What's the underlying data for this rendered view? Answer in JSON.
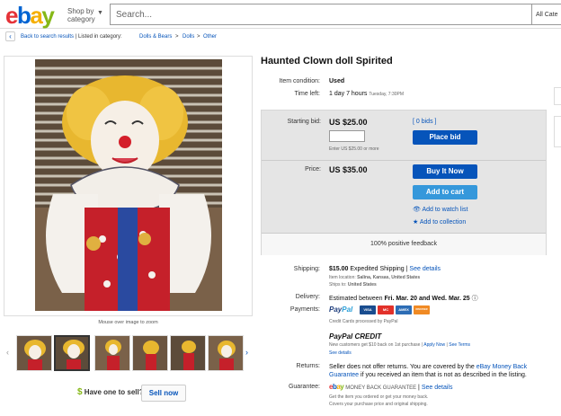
{
  "header": {
    "logo": {
      "e": "e",
      "b": "b",
      "a": "a",
      "y": "y"
    },
    "shop_by_line1": "Shop by",
    "shop_by_line2": "category",
    "search_placeholder": "Search...",
    "search_category": "All Cate"
  },
  "breadcrumb": {
    "back": "Back to search results",
    "listed": "Listed in category:",
    "items": [
      "Dolls & Bears",
      "Dolls",
      "Other"
    ],
    "separator": ">"
  },
  "gallery": {
    "zoom_hint": "Mouse over image to zoom",
    "thumbnail_count": 6,
    "selected_index": 1
  },
  "sell": {
    "dollar": "$",
    "prompt": "Have one to sell?",
    "button": "Sell now"
  },
  "item": {
    "title": "Haunted Clown doll Spirited",
    "condition_label": "Item condition:",
    "condition_value": "Used",
    "time_left_label": "Time left:",
    "time_left_value": "1 day 7 hours",
    "time_left_when": "Tuesday, 7:30PM"
  },
  "bid": {
    "starting_label": "Starting bid:",
    "starting_value": "US $25.00",
    "bids_link": "[ 0 bids ]",
    "hint": "Enter US $25.00 or more",
    "place_bid": "Place bid",
    "price_label": "Price:",
    "price_value": "US $35.00",
    "buy_now": "Buy It Now",
    "add_to_cart": "Add to cart",
    "watch": "Add to watch list",
    "collection": "Add to collection",
    "feedback": "100% positive feedback"
  },
  "shipping": {
    "label": "Shipping:",
    "cost": "$15.00",
    "method": "Expedited Shipping",
    "details": "See details",
    "location_label": "Item location:",
    "location": "Salina, Kansas, United States",
    "ships_to_label": "Ships to:",
    "ships_to": "United States"
  },
  "delivery": {
    "label": "Delivery:",
    "text": "Estimated between",
    "dates": "Fri. Mar. 20 and Wed. Mar. 25"
  },
  "payments": {
    "label": "Payments:",
    "paypal_p1": "Pay",
    "paypal_p2": "Pal",
    "cards": [
      "VISA",
      "MC",
      "AMEX",
      "DISCOVER"
    ],
    "processed": "Credit Cards processed by PayPal",
    "credit_title": "PayPal CREDIT",
    "credit_offer": "New customers get $10 back on 1st purchase",
    "apply_now": "Apply Now",
    "see_terms": "See Terms",
    "see_details": "See details"
  },
  "returns": {
    "label": "Returns:",
    "text": "Seller does not offer returns. You are covered by the",
    "link": "eBay Money Back Guarantee",
    "text2": "if you received an item that is not as described in the listing."
  },
  "guarantee": {
    "label": "Guarantee:",
    "brand": "MONEY BACK GUARANTEE",
    "details": "See details",
    "line1": "Get the item you ordered or get your money back.",
    "line2": "Covers your purchase price and original shipping."
  },
  "colors": {
    "primary": "#0654ba",
    "panel": "#e5e5e5",
    "link": "#0654ba"
  }
}
